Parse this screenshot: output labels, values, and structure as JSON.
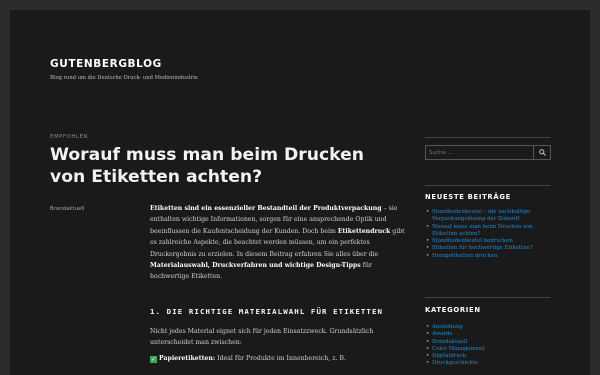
{
  "site": {
    "title": "GUTENBERGBLOG",
    "description": "Blog rund um die Deutsche Druck- und Medienindustrie"
  },
  "post": {
    "category_label": "EMPFOHLEN",
    "title": "Worauf muss man beim Drucken von Etiketten achten?",
    "meta_category": "Brandaktuell",
    "intro": {
      "b1": "Etiketten sind ein essenzieller Bestandteil der Produktverpackung",
      "t1": " – sie enthalten wichtige Informationen, sorgen für eine ansprechende Optik und beeinflussen die Kaufentscheidung der Kunden. Doch beim ",
      "b2": "Etikettendruck",
      "t2": " gibt es zahlreiche Aspekte, die beachtet werden müssen, um ein perfektes Druckergebnis zu erzielen. In diesem Beitrag erfahren Sie alles über die ",
      "b3": "Materialauswahl, Druckverfahren und wichtige Design-Tipps",
      "t3": " für hochwertige Etiketten."
    },
    "section_heading": "1. DIE RICHTIGE MATERIALWAHL FÜR ETIKETTEN",
    "section_text": "Nicht jedes Material eignet sich für jeden Einsatzzweck. Grundsätzlich unterscheidet man zwischen:",
    "bullet_bold": "Papieretiketten:",
    "bullet_text": " Ideal für Produkte im Innenbereich, z. B."
  },
  "sidebar": {
    "search_placeholder": "Suche …",
    "recent_title": "NEUESTE BEITRÄGE",
    "recent_posts": [
      "Standbodenbeutel – die nachhaltige Verpackungslösung der Zukunft",
      "Worauf muss man beim Drucken von Etiketten achten?",
      "Standbodenbeutel bedrucken",
      "Etiketten für hochwertige Etiketten?",
      "Honigetiketten drucken"
    ],
    "categories_title": "KATEGORIEN",
    "categories": [
      "Ausbildung",
      "Awards",
      "Brandaktuell",
      "Color Management",
      "Digitaldruck",
      "Druckgeschichte"
    ]
  },
  "colors": {
    "background": "#1a1a1a",
    "link": "#1e8cd4",
    "check": "#3aa757"
  }
}
